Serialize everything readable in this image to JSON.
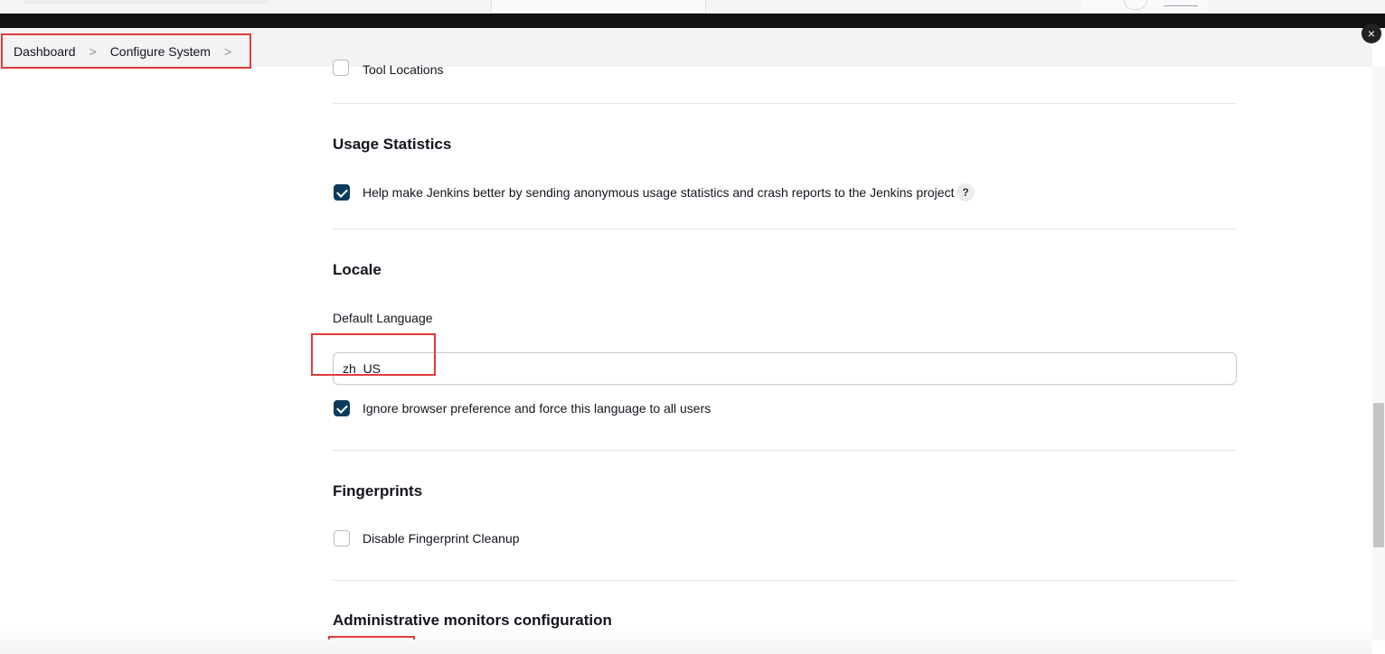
{
  "breadcrumb": {
    "items": [
      "Dashboard",
      "Configure System"
    ],
    "separator": ">"
  },
  "close_label": "×",
  "sections": {
    "tool_locations": {
      "label": "Tool Locations",
      "checked": false
    },
    "usage_statistics": {
      "title": "Usage Statistics",
      "option_label": "Help make Jenkins better by sending anonymous usage statistics and crash reports to the Jenkins project",
      "checked": true,
      "help_icon": "?"
    },
    "locale": {
      "title": "Locale",
      "default_language_label": "Default Language",
      "default_language_value": "zh_US",
      "ignore_browser_label": "Ignore browser preference and force this language to all users",
      "ignore_checked": true
    },
    "fingerprints": {
      "title": "Fingerprints",
      "option_label": "Disable Fingerprint Cleanup",
      "checked": false
    },
    "admin_monitors": {
      "title": "Administrative monitors configuration"
    }
  },
  "colors": {
    "checkbox_checked": "#0d3b5e",
    "highlight_red": "#e03c3c"
  }
}
